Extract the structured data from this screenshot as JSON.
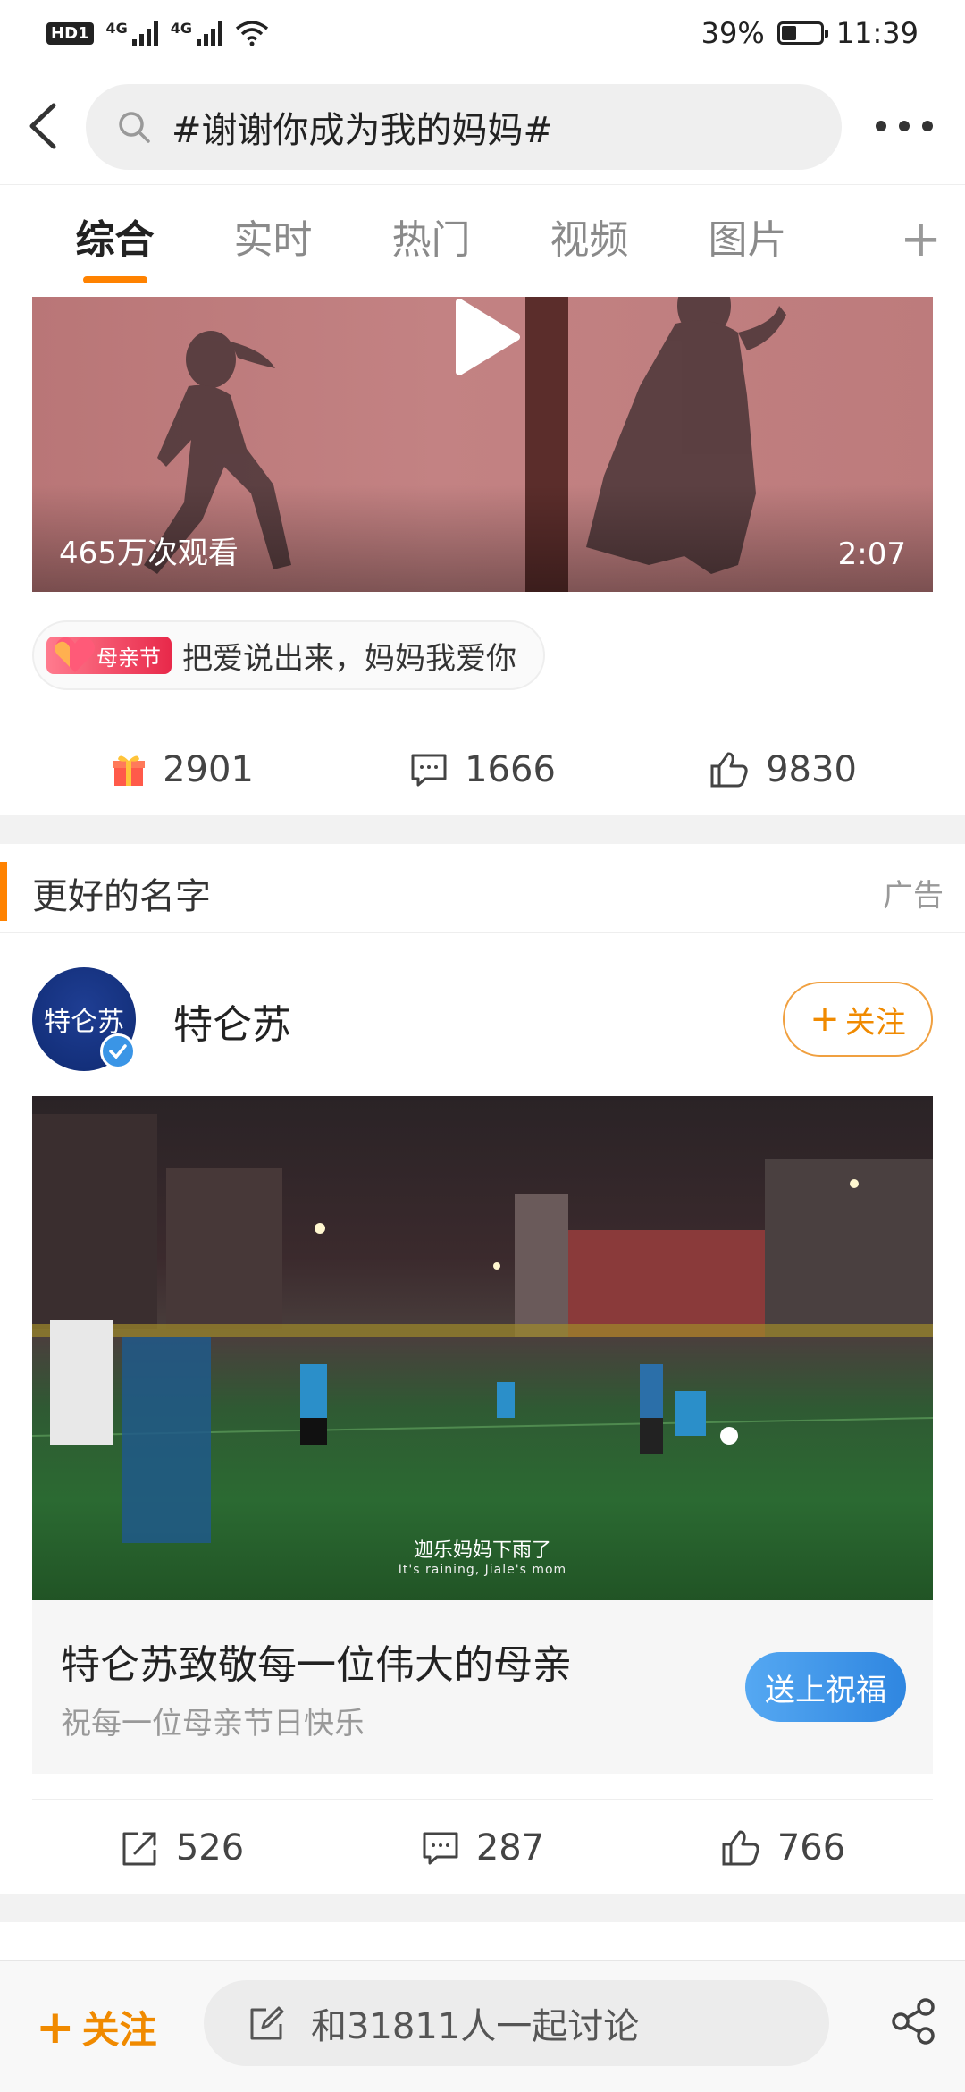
{
  "status_bar": {
    "badge": "HD1",
    "signal1": "4G",
    "signal2": "4G",
    "battery": "39%",
    "battery_level": 0.39,
    "time": "11:39"
  },
  "header": {
    "search_query": "#谢谢你成为我的妈妈#"
  },
  "tabs": [
    {
      "label": "综合",
      "active": true
    },
    {
      "label": "实时",
      "active": false
    },
    {
      "label": "热门",
      "active": false
    },
    {
      "label": "视频",
      "active": false
    },
    {
      "label": "图片",
      "active": false
    }
  ],
  "tabs_more": "+",
  "post1": {
    "views": "465万次观看",
    "duration": "2:07",
    "topic_badge": "母亲节",
    "topic_text": "把爱说出来，妈妈我爱你",
    "gift_count": "2901",
    "comment_count": "1666",
    "like_count": "9830"
  },
  "section": {
    "title": "更好的名字",
    "ad_label": "广告"
  },
  "post2": {
    "author": "特仑苏",
    "avatar_text": "特仑苏",
    "follow_label": "关注",
    "subtitle_cn": "迦乐妈妈下雨了",
    "subtitle_en": "It's raining, Jiale's mom",
    "promo_title": "特仑苏致敬每一位伟大的母亲",
    "promo_sub": "祝每一位母亲节日快乐",
    "promo_button": "送上祝福",
    "repost_count": "526",
    "comment_count": "287",
    "like_count": "766"
  },
  "bottom_bar": {
    "follow_label": "关注",
    "discuss_text": "和31811人一起讨论"
  },
  "colors": {
    "accent": "#ff8200",
    "blue_button": "#3a95e6"
  }
}
